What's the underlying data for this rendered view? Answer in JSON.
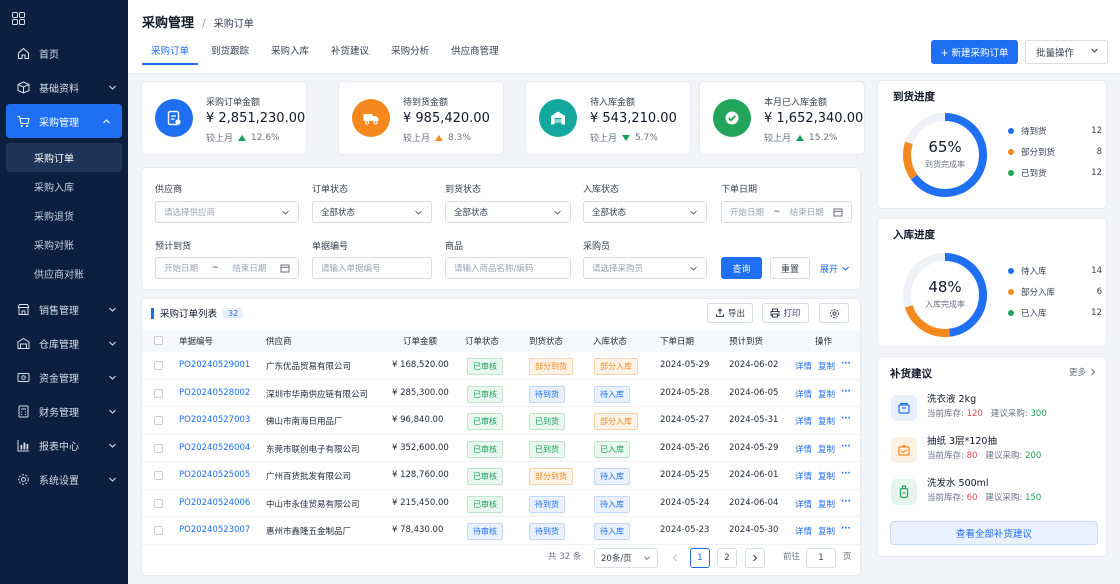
{
  "sidebar": {
    "items": [
      {
        "label": "首页",
        "icon": "home-icon"
      },
      {
        "label": "基础资料",
        "icon": "cube-icon"
      },
      {
        "label": "采购管理",
        "icon": "cart-icon"
      },
      {
        "label": "销售管理",
        "icon": "store-icon"
      },
      {
        "label": "仓库管理",
        "icon": "warehouse-icon"
      },
      {
        "label": "资金管理",
        "icon": "money-icon"
      },
      {
        "label": "财务管理",
        "icon": "calculator-icon"
      },
      {
        "label": "报表中心",
        "icon": "chart-icon"
      },
      {
        "label": "系统设置",
        "icon": "gear-icon"
      }
    ],
    "subitems": [
      "采购订单",
      "采购入库",
      "采购退货",
      "采购对账",
      "供应商对账"
    ]
  },
  "header": {
    "breadcrumb_root": "采购管理",
    "breadcrumb_sep": "/",
    "breadcrumb_current": "采购订单",
    "tabs": [
      "采购订单",
      "到货跟踪",
      "采购入库",
      "补货建议",
      "采购分析",
      "供应商管理"
    ],
    "new_button": "+ 新建采购订单",
    "batch_button": "批量操作"
  },
  "kpis": [
    {
      "title": "采购订单金额",
      "value": "¥ 2,851,230.00",
      "compare": "较上月",
      "change": "12.6%",
      "dir": "up",
      "color": "#1e6ff2",
      "icon": "order-icon"
    },
    {
      "title": "待到货金额",
      "value": "¥ 985,420.00",
      "compare": "较上月",
      "change": "8.3%",
      "dir": "up",
      "color": "#f5891f",
      "icon": "truck-icon"
    },
    {
      "title": "待入库金额",
      "value": "¥ 543,210.00",
      "compare": "较上月",
      "change": "5.7%",
      "dir": "down",
      "color": "#13a89e",
      "icon": "warehouse-icon"
    },
    {
      "title": "本月已入库金额",
      "value": "¥ 1,652,340.00",
      "compare": "较上月",
      "change": "15.2%",
      "dir": "up",
      "color": "#22a55a",
      "icon": "check-icon"
    }
  ],
  "filters": {
    "supplier_label": "供应商",
    "supplier_ph": "请选择供应商",
    "order_status_label": "订单状态",
    "order_status_val": "全部状态",
    "arrival_status_label": "到货状态",
    "arrival_status_val": "全部状态",
    "stock_status_label": "入库状态",
    "stock_status_val": "全部状态",
    "order_date_label": "下单日期",
    "start_ph": "开始日期",
    "tilde": "~",
    "end_ph": "结束日期",
    "expected_label": "预计到货",
    "doc_no_label": "单据编号",
    "doc_no_ph": "请输入单据编号",
    "product_label": "商品",
    "product_ph": "请输入商品名称/编码",
    "buyer_label": "采购员",
    "buyer_ph": "请选择采购员",
    "query": "查询",
    "reset": "重置",
    "expand": "展开"
  },
  "table": {
    "title": "采购订单列表",
    "count": "32",
    "export": "导出",
    "print": "打印",
    "headers": [
      "单据编号",
      "供应商",
      "订单金额",
      "订单状态",
      "到货状态",
      "入库状态",
      "下单日期",
      "预计到货",
      "操作"
    ],
    "rows": [
      {
        "no": "PO20240529001",
        "supplier": "广东优品贸易有限公司",
        "amount": "¥ 168,520.00",
        "order_status": "已审核",
        "os_color": "green",
        "arrival": "部分到货",
        "ar_color": "orange",
        "stock": "部分入库",
        "st_color": "orange",
        "date": "2024-05-29",
        "expected": "2024-06-02"
      },
      {
        "no": "PO20240528002",
        "supplier": "深圳市华南供应链有限公司",
        "amount": "¥ 285,300.00",
        "order_status": "已审核",
        "os_color": "green",
        "arrival": "待到货",
        "ar_color": "blue",
        "stock": "待入库",
        "st_color": "blue",
        "date": "2024-05-28",
        "expected": "2024-06-05"
      },
      {
        "no": "PO20240527003",
        "supplier": "佛山市南海日用品厂",
        "amount": "¥ 96,840.00",
        "order_status": "已审核",
        "os_color": "green",
        "arrival": "已到货",
        "ar_color": "green",
        "stock": "部分入库",
        "st_color": "orange",
        "date": "2024-05-27",
        "expected": "2024-05-31"
      },
      {
        "no": "PO20240526004",
        "supplier": "东莞市联创电子有限公司",
        "amount": "¥ 352,600.00",
        "order_status": "已审核",
        "os_color": "green",
        "arrival": "已到货",
        "ar_color": "green",
        "stock": "已入库",
        "st_color": "green",
        "date": "2024-05-26",
        "expected": "2024-05-29"
      },
      {
        "no": "PO20240525005",
        "supplier": "广州百货批发有限公司",
        "amount": "¥ 128,760.00",
        "order_status": "已审核",
        "os_color": "green",
        "arrival": "部分到货",
        "ar_color": "orange",
        "stock": "待入库",
        "st_color": "blue",
        "date": "2024-05-25",
        "expected": "2024-06-01"
      },
      {
        "no": "PO20240524006",
        "supplier": "中山市永佳贸易有限公司",
        "amount": "¥ 215,450.00",
        "order_status": "已审核",
        "os_color": "green",
        "arrival": "待到货",
        "ar_color": "blue",
        "stock": "待入库",
        "st_color": "blue",
        "date": "2024-05-24",
        "expected": "2024-06-04"
      },
      {
        "no": "PO20240523007",
        "supplier": "惠州市鑫隆五金制品厂",
        "amount": "¥ 78,430.00",
        "order_status": "待审核",
        "os_color": "blue",
        "arrival": "待到货",
        "ar_color": "blue",
        "stock": "待入库",
        "st_color": "blue",
        "date": "2024-05-23",
        "expected": "2024-05-30"
      }
    ],
    "action_detail": "详情",
    "action_copy": "复制",
    "action_more": "···"
  },
  "pagination": {
    "total": "共 32 条",
    "page_size": "20条/页",
    "pages": [
      "1",
      "2"
    ],
    "goto_label": "前往",
    "goto_value": "1",
    "page_suffix": "页"
  },
  "arrival_progress": {
    "title": "到货进度",
    "percent": "65%",
    "percent_value": 65,
    "caption": "到货完成率",
    "legend": [
      {
        "label": "待到货",
        "value": "12",
        "color": "#1e6ff2"
      },
      {
        "label": "部分到货",
        "value": "8",
        "color": "#f5891f"
      },
      {
        "label": "已到货",
        "value": "12",
        "color": "#22a55a"
      }
    ]
  },
  "stock_progress": {
    "title": "入库进度",
    "percent": "48%",
    "percent_value": 48,
    "caption": "入库完成率",
    "legend": [
      {
        "label": "待入库",
        "value": "14",
        "color": "#1e6ff2"
      },
      {
        "label": "部分入库",
        "value": "6",
        "color": "#f5891f"
      },
      {
        "label": "已入库",
        "value": "12",
        "color": "#22a55a"
      }
    ]
  },
  "replenish": {
    "title": "补货建议",
    "more": "更多",
    "items": [
      {
        "name": "洗衣液 2kg",
        "stock_label": "当前库存:",
        "stock": "120",
        "suggest_label": "建议采购:",
        "suggest": "300",
        "icon": "box-icon",
        "color": "#1e6ff2",
        "bg": "#e8f0fe"
      },
      {
        "name": "抽纸 3层*120抽",
        "stock_label": "当前库存:",
        "stock": "80",
        "suggest_label": "建议采购:",
        "suggest": "200",
        "icon": "tissue-icon",
        "color": "#f5891f",
        "bg": "#fef1e3"
      },
      {
        "name": "洗发水 500ml",
        "stock_label": "当前库存:",
        "stock": "60",
        "suggest_label": "建议采购:",
        "suggest": "150",
        "icon": "bottle-icon",
        "color": "#22a55a",
        "bg": "#e7f6ed"
      }
    ],
    "view_all": "查看全部补货建议"
  },
  "colors": {
    "primary": "#1e6ff2",
    "sidebar": "#0c1f3f",
    "green": "#18a058",
    "orange": "#f08a24",
    "red": "#e5484d"
  }
}
